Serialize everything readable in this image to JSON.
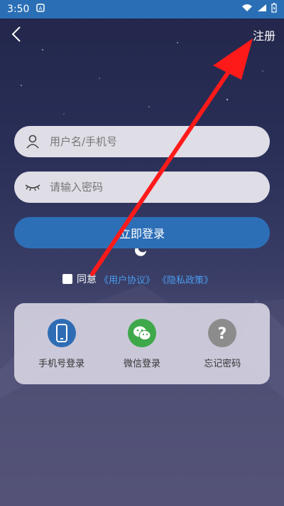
{
  "status_bar": {
    "time": "3:50"
  },
  "header": {
    "register_label": "注册"
  },
  "form": {
    "username_placeholder": "用户名/手机号",
    "password_placeholder": "请输入密码",
    "login_label": "立即登录"
  },
  "agreement": {
    "agree_label": "同意",
    "user_agreement": "《用户协议》",
    "privacy_policy": "《隐私政策》"
  },
  "quick_login": [
    {
      "label": "手机号登录",
      "icon": "phone-icon",
      "color": "#2e6db5"
    },
    {
      "label": "微信登录",
      "icon": "wechat-icon",
      "color": "#3ea84a"
    },
    {
      "label": "忘记密码",
      "icon": "question-icon",
      "color": "#8c8c8c"
    }
  ],
  "colors": {
    "status_bar": "#2a6fb5",
    "login_button": "#2d6fb7",
    "link": "#4a9cf0",
    "annotation_arrow": "#ff1a1a"
  }
}
